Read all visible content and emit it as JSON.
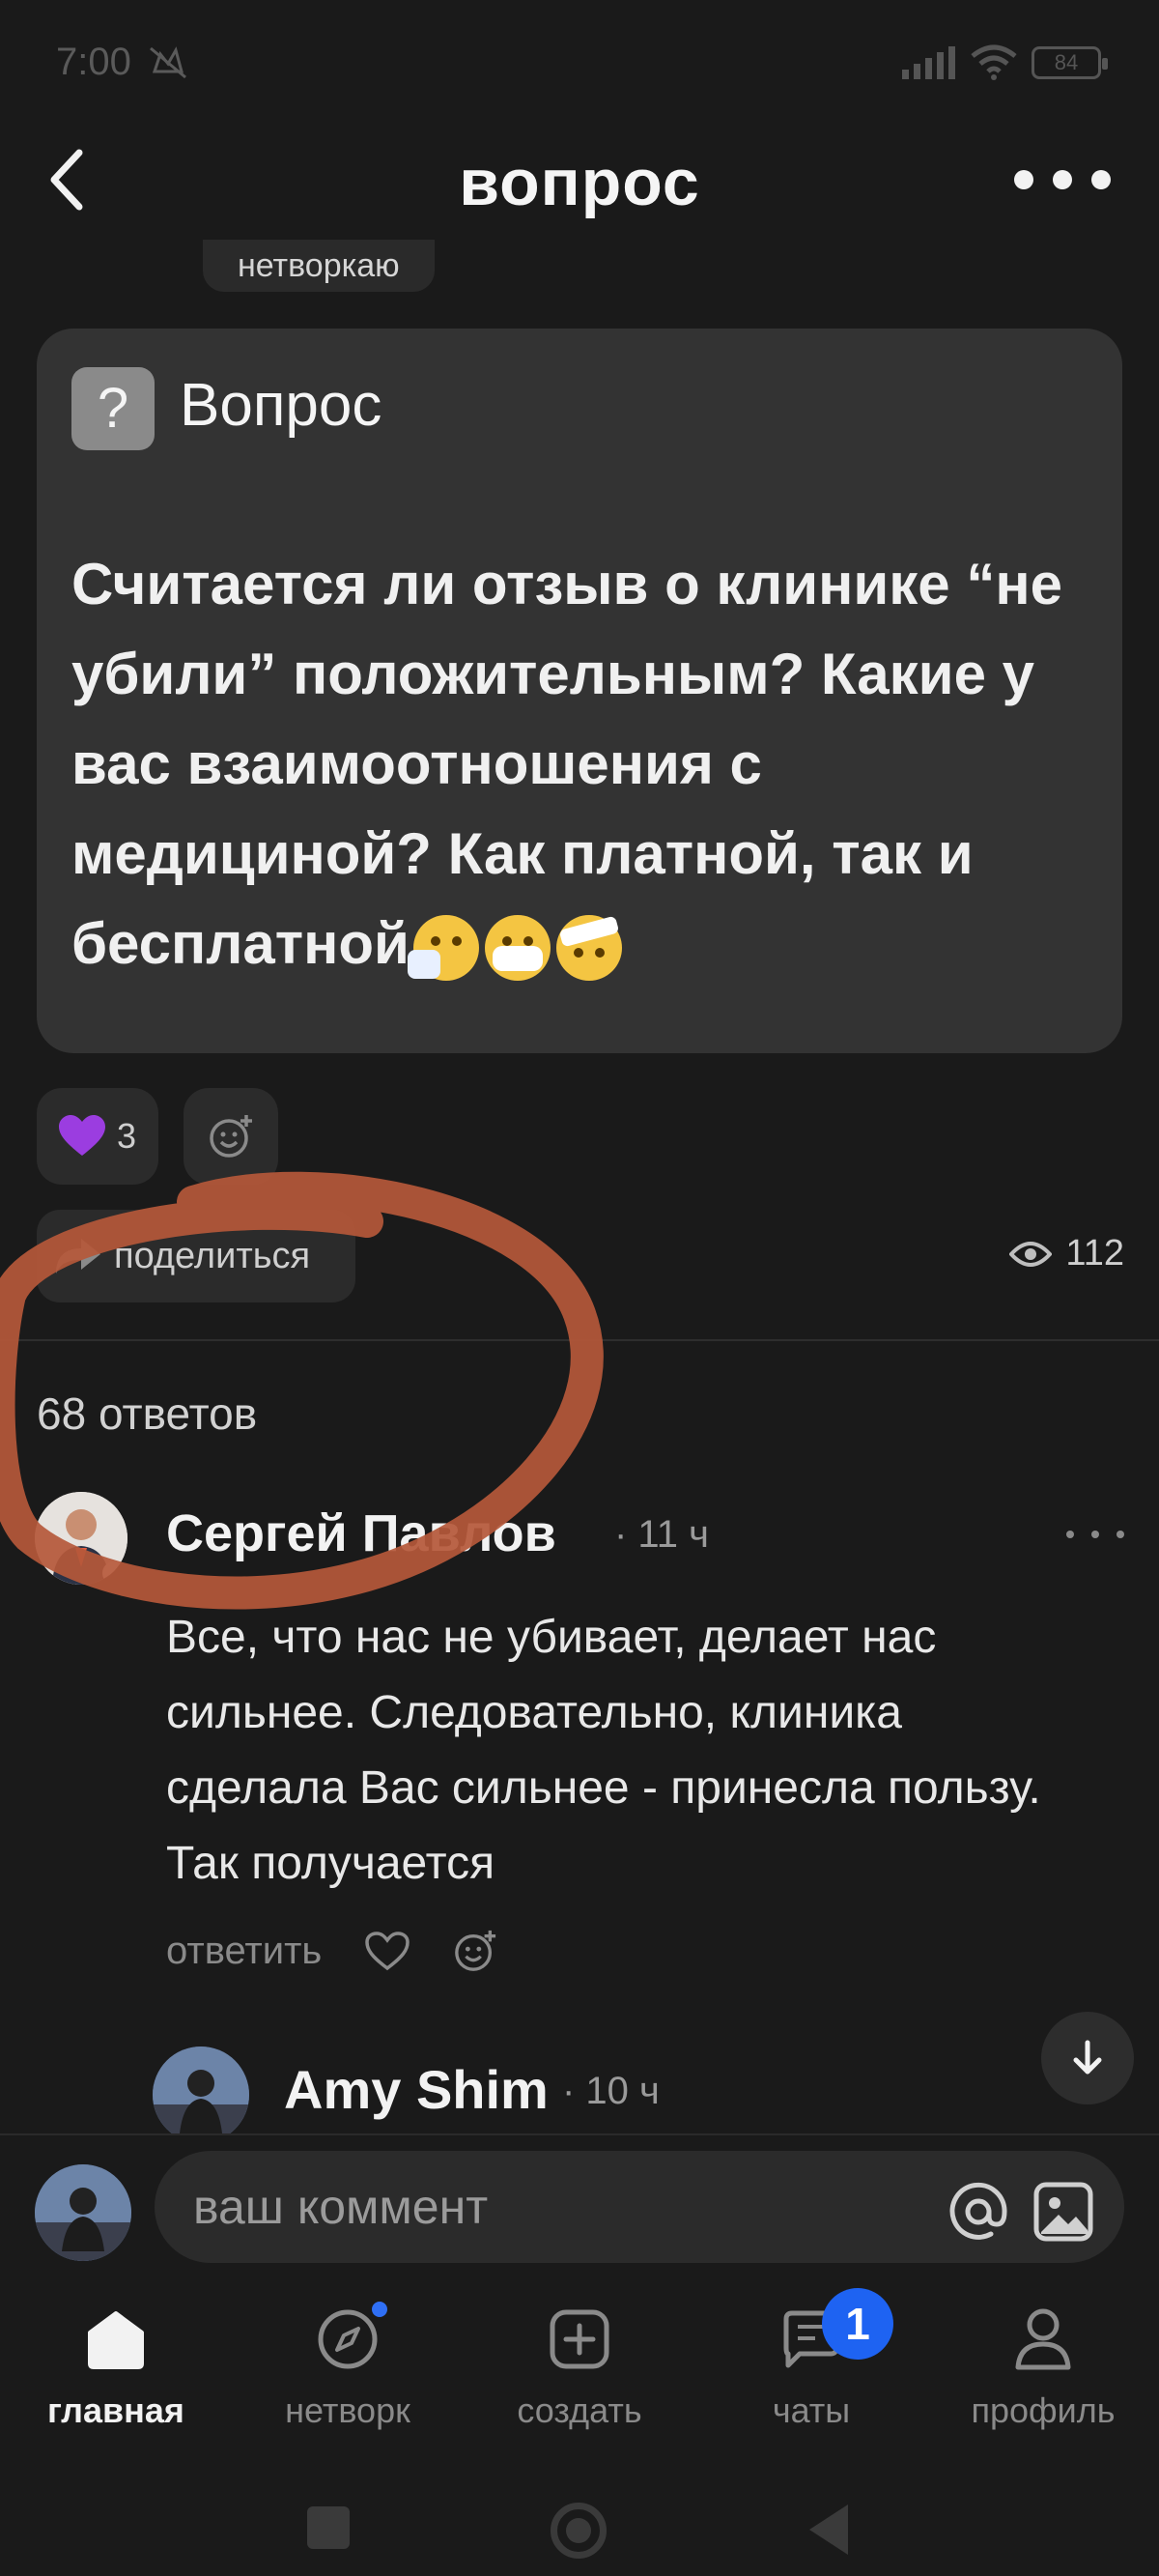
{
  "status_bar": {
    "time": "7:00",
    "battery": "84"
  },
  "header": {
    "title": "вопрос"
  },
  "tag_chip": "нетворкаю",
  "question": {
    "label": "Вопрос",
    "badge": "?",
    "text": "Считается ли отзыв о клинике “не убили” положительным? Какие у вас взаимоотношения с медициной? Как платной, так и бесплатной"
  },
  "reactions": {
    "like_count": "3"
  },
  "share": {
    "label": "поделиться"
  },
  "views": {
    "count": "112"
  },
  "answers": {
    "count_label": "68 ответов"
  },
  "comment": {
    "author": "Сергей Павлов",
    "time": "· 11 ч",
    "text": "Все, что нас не убивает, делает нас сильнее. Следовательно, клиника сделала Вас сильнее - принесла пользу. Так получается",
    "reply_label": "ответить"
  },
  "reply": {
    "author": "Amy Shim",
    "time": "· 10 ч"
  },
  "input": {
    "placeholder": "ваш коммент"
  },
  "bottom_nav": {
    "items": [
      {
        "label": "главная"
      },
      {
        "label": "нетворк"
      },
      {
        "label": "создать"
      },
      {
        "label": "чаты",
        "badge": "1"
      },
      {
        "label": "профиль"
      }
    ]
  },
  "colors": {
    "annotation": "#b5583a",
    "accent_blue": "#1e63f2",
    "like_purple": "#9b3de0"
  }
}
